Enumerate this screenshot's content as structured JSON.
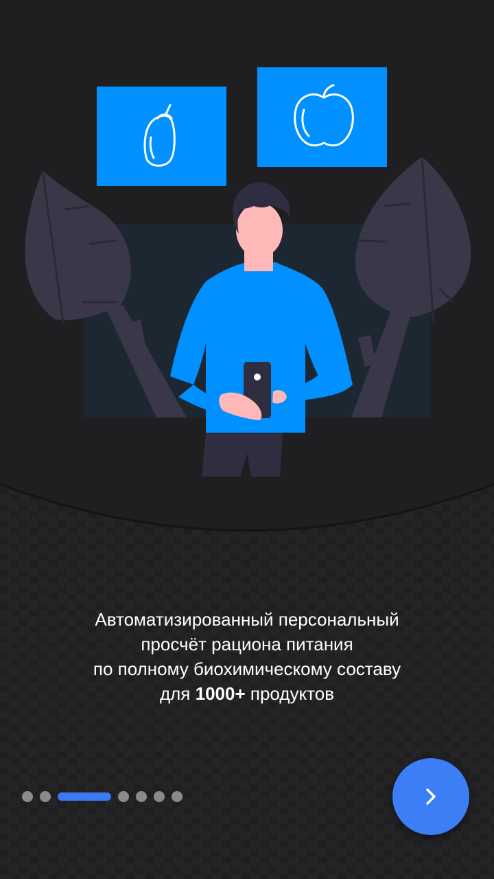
{
  "onboarding": {
    "description_line1": "Автоматизированный персональный",
    "description_line2": "просчёт рациона питания",
    "description_line3": "по полному биохимическому составу",
    "description_line4_prefix": "для ",
    "description_line4_bold": "1000+",
    "description_line4_suffix": " продуктов"
  },
  "pager": {
    "total_pages": 7,
    "current_page": 3
  },
  "next_button": {
    "icon": "chevron-right-icon"
  },
  "colors": {
    "background": "#1f1e20",
    "accent_blue": "#0090ff",
    "button_blue": "#3b7ef5",
    "indicator_active": "#3a7af2",
    "indicator_inactive": "#8a8a8c",
    "leaf": "#3a3848",
    "skin": "#ffb8b8"
  }
}
